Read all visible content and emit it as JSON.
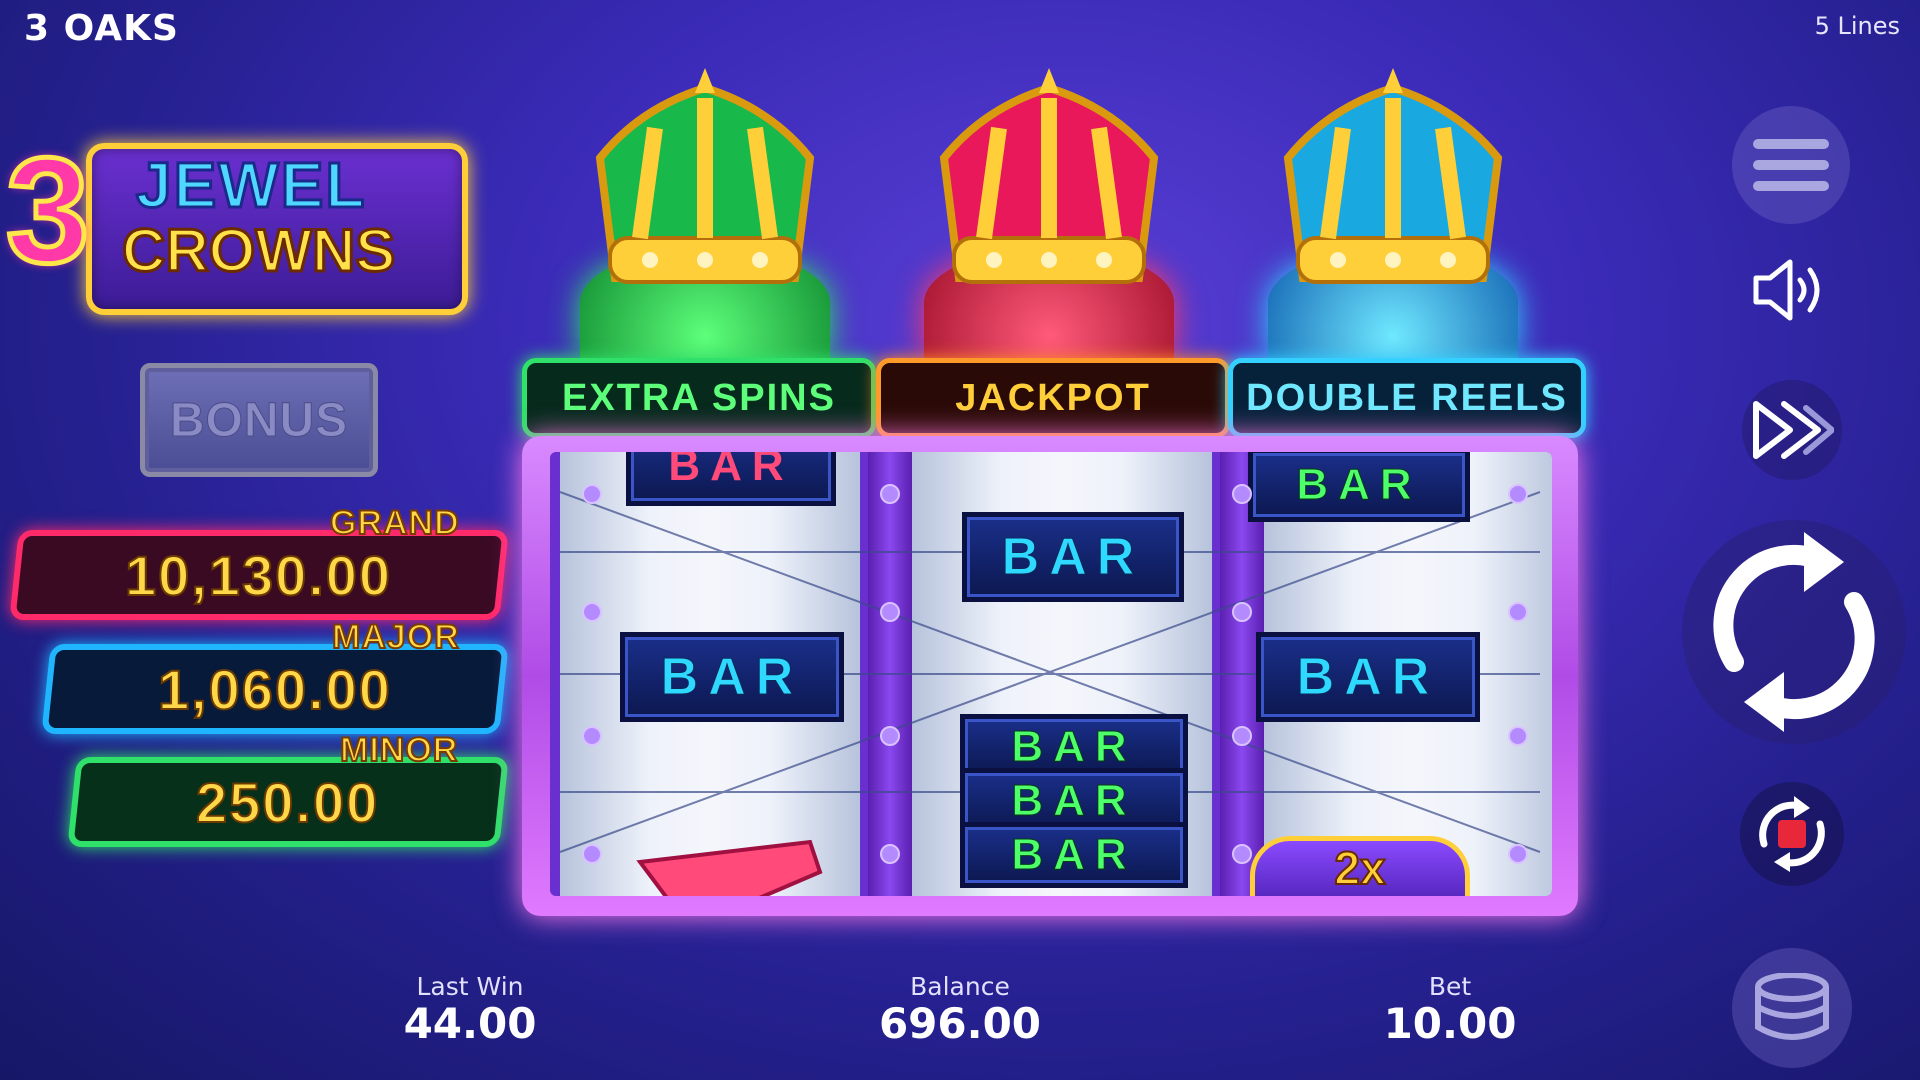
{
  "header": {
    "provider": "3 OAKS",
    "lines": "5 Lines"
  },
  "logo": {
    "number": "3",
    "line1": "JEWEL",
    "line2": "CROWNS"
  },
  "bonus": {
    "label": "BONUS"
  },
  "jackpots": {
    "grand": {
      "label": "GRAND",
      "value": "10,130.00"
    },
    "major": {
      "label": "MAJOR",
      "value": "1,060.00"
    },
    "minor": {
      "label": "MINOR",
      "value": "250.00"
    }
  },
  "features": {
    "extra_spins": "EXTRA SPINS",
    "jackpot": "JACKPOT",
    "double_reels": "DOUBLE REELS"
  },
  "reels": {
    "symbol_text": "BAR",
    "reel1": [
      "BAR",
      "BAR"
    ],
    "reel2": [
      "BAR",
      "BAR",
      "BAR",
      "BAR"
    ],
    "reel3": [
      "BAR",
      "BAR"
    ],
    "partial_multiplier": "2x"
  },
  "crowns": {
    "left_color": "#19b84a",
    "center_color": "#e8185a",
    "right_color": "#1aa8e0"
  },
  "stats": {
    "last_win_label": "Last Win",
    "last_win": "44.00",
    "balance_label": "Balance",
    "balance": "696.00",
    "bet_label": "Bet",
    "bet": "10.00"
  },
  "controls": [
    "menu-icon",
    "sound-icon",
    "turbo-icon",
    "spin-icon",
    "autoplay-stop-icon",
    "bet-coins-icon"
  ]
}
